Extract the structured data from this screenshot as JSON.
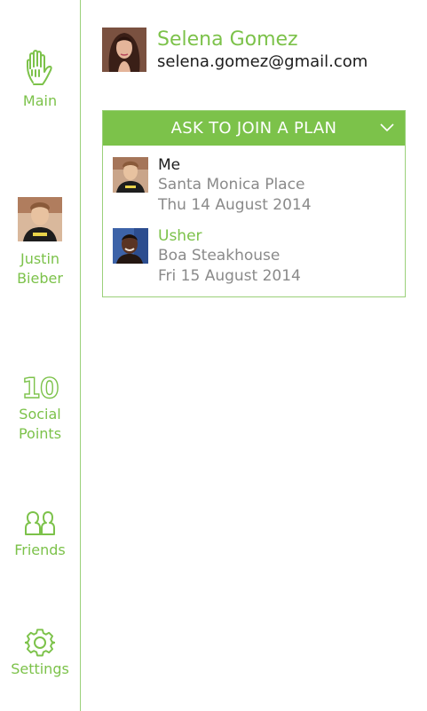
{
  "sidebar": {
    "main_label": "Main",
    "profile_name_line1": "Justin",
    "profile_name_line2": "Bieber",
    "points_value": "10",
    "points_label_line1": "Social",
    "points_label_line2": "Points",
    "friends_label": "Friends",
    "settings_label": "Settings"
  },
  "user": {
    "name": "Selena Gomez",
    "email": "selena.gomez@gmail.com"
  },
  "plan": {
    "header_label": "ASK TO JOIN A PLAN",
    "items": [
      {
        "who": "Me",
        "place": "Santa Monica Place",
        "date": "Thu 14 August 2014"
      },
      {
        "who": "Usher",
        "place": "Boa Steakhouse",
        "date": "Fri 15 August 2014"
      }
    ]
  },
  "colors": {
    "accent": "#7cc24a",
    "border": "#9bd07a",
    "text_dark": "#1c1c1c",
    "text_muted": "#8a8a8a"
  },
  "icons": {
    "main": "hand-icon",
    "friends": "friends-icon",
    "settings": "gear-icon",
    "plan_header": "chevron-down-icon"
  }
}
